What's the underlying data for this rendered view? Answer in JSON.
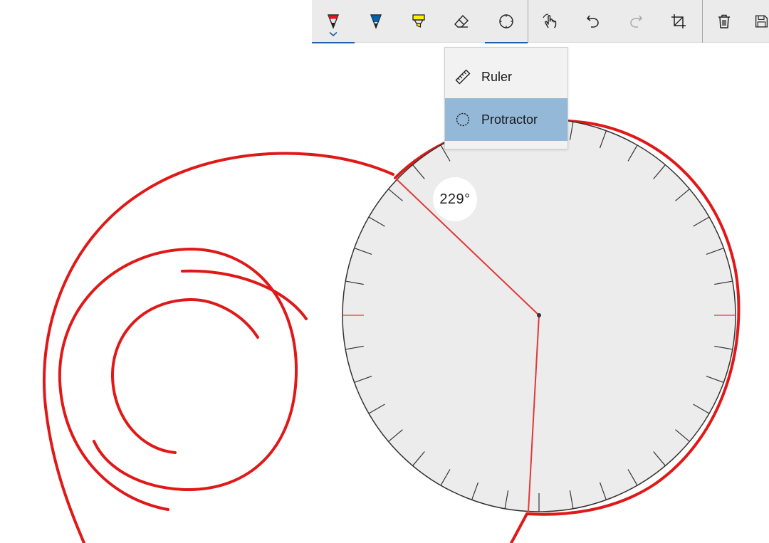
{
  "toolbar": {
    "tools": [
      {
        "name": "ballpoint-pen",
        "color": "#e81123"
      },
      {
        "name": "pencil",
        "color": "#0063b1"
      },
      {
        "name": "highlighter",
        "color": "#fff100"
      },
      {
        "name": "eraser"
      },
      {
        "name": "protractor"
      },
      {
        "name": "touch-writing"
      },
      {
        "name": "undo"
      },
      {
        "name": "redo",
        "disabled": true
      },
      {
        "name": "crop"
      },
      {
        "name": "delete"
      },
      {
        "name": "save"
      }
    ]
  },
  "stencil_menu": {
    "items": [
      {
        "label": "Ruler",
        "icon": "ruler-icon",
        "selected": false
      },
      {
        "label": "Protractor",
        "icon": "protractor-icon",
        "selected": true
      }
    ]
  },
  "protractor": {
    "angle_label": "229°",
    "angle_degrees": 229
  },
  "colors": {
    "ink": "#e01818",
    "protractor_fill": "#ececec",
    "accent": "#1d5fa8",
    "menu_selected": "#93b8d8"
  }
}
